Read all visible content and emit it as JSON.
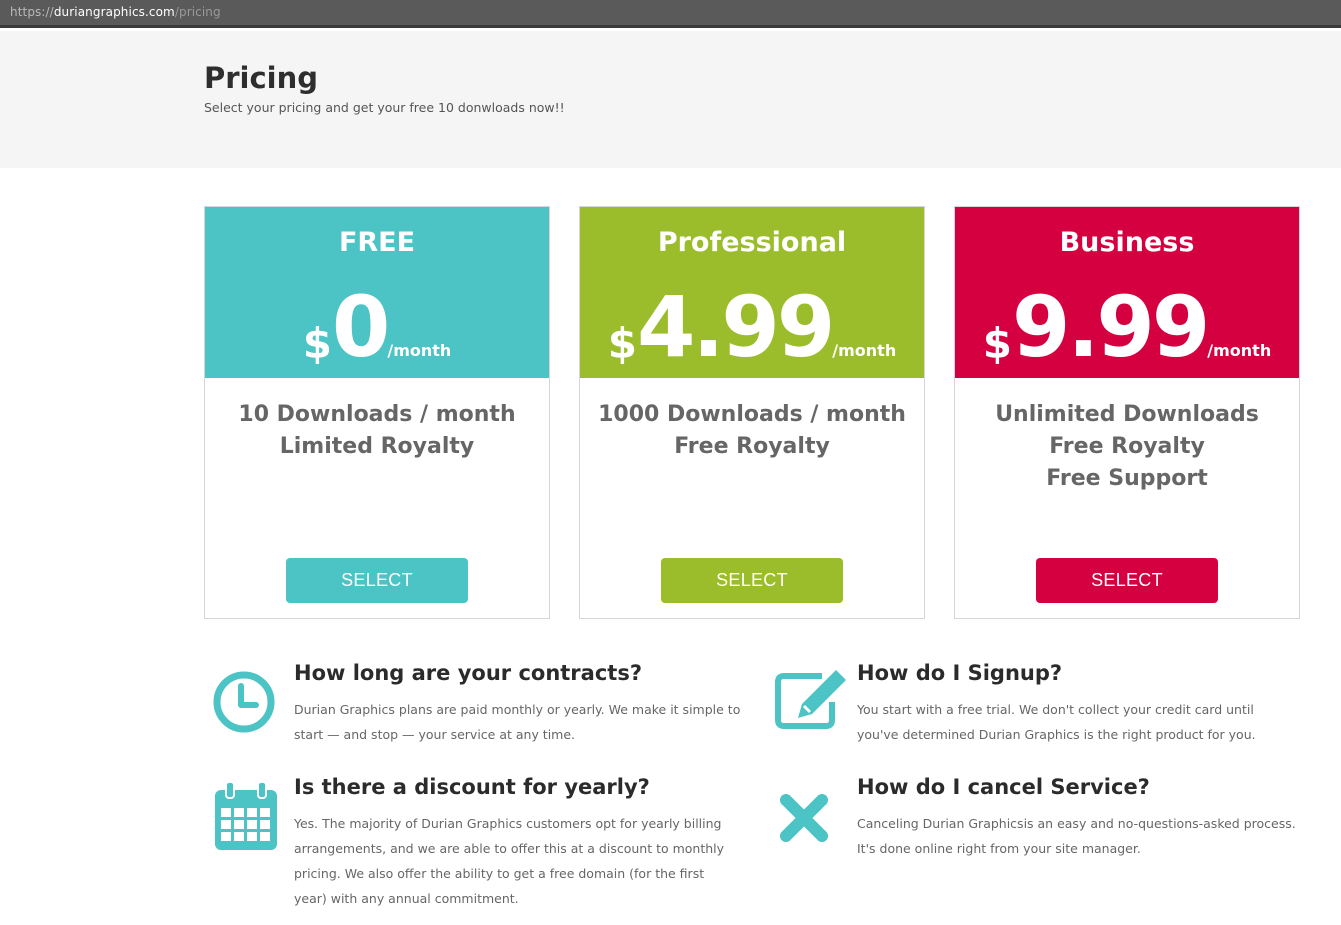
{
  "browser": {
    "url_host_prefix": "https://",
    "url_host": "duriangraphics.com",
    "url_path": "/pricing"
  },
  "header": {
    "title": "Pricing",
    "subtitle": "Select your pricing and get your free 10 donwloads now!!"
  },
  "plans": [
    {
      "name": "FREE",
      "currency": "$",
      "amount": "0",
      "period": "/month",
      "features": [
        "10 Downloads / month",
        "Limited Royalty"
      ],
      "button": "SELECT",
      "color": "#4cc3c4"
    },
    {
      "name": "Professional",
      "currency": "$",
      "amount": "4.99",
      "period": "/month",
      "features": [
        "1000 Downloads / month",
        "Free Royalty"
      ],
      "button": "SELECT",
      "color": "#9bbd2c"
    },
    {
      "name": "Business",
      "currency": "$",
      "amount": "9.99",
      "period": "/month",
      "features": [
        "Unlimited Downloads",
        "Free Royalty",
        "Free Support"
      ],
      "button": "SELECT",
      "color": "#d4003f"
    }
  ],
  "faq": [
    {
      "icon": "clock-icon",
      "question": "How long are your contracts?",
      "answer": "Durian Graphics plans are paid monthly or yearly. We make it simple to start — and stop — your service at any time."
    },
    {
      "icon": "edit-icon",
      "question": "How do I Signup?",
      "answer": "You start with a free trial. We don't collect your credit card until you've determined Durian Graphics is the right product for you."
    },
    {
      "icon": "calendar-icon",
      "question": "Is there a discount for yearly?",
      "answer": "Yes. The majority of Durian Graphics customers opt for yearly billing arrangements, and we are able to offer this at a discount to monthly pricing. We also offer the ability to get a free domain (for the first year) with any annual commitment."
    },
    {
      "icon": "close-icon",
      "question": "How do I cancel Service?",
      "answer": "Canceling Durian Graphicsis an easy and no-questions-asked process. It's done online right from your site manager."
    }
  ],
  "icon_color": "#4cc3c4"
}
